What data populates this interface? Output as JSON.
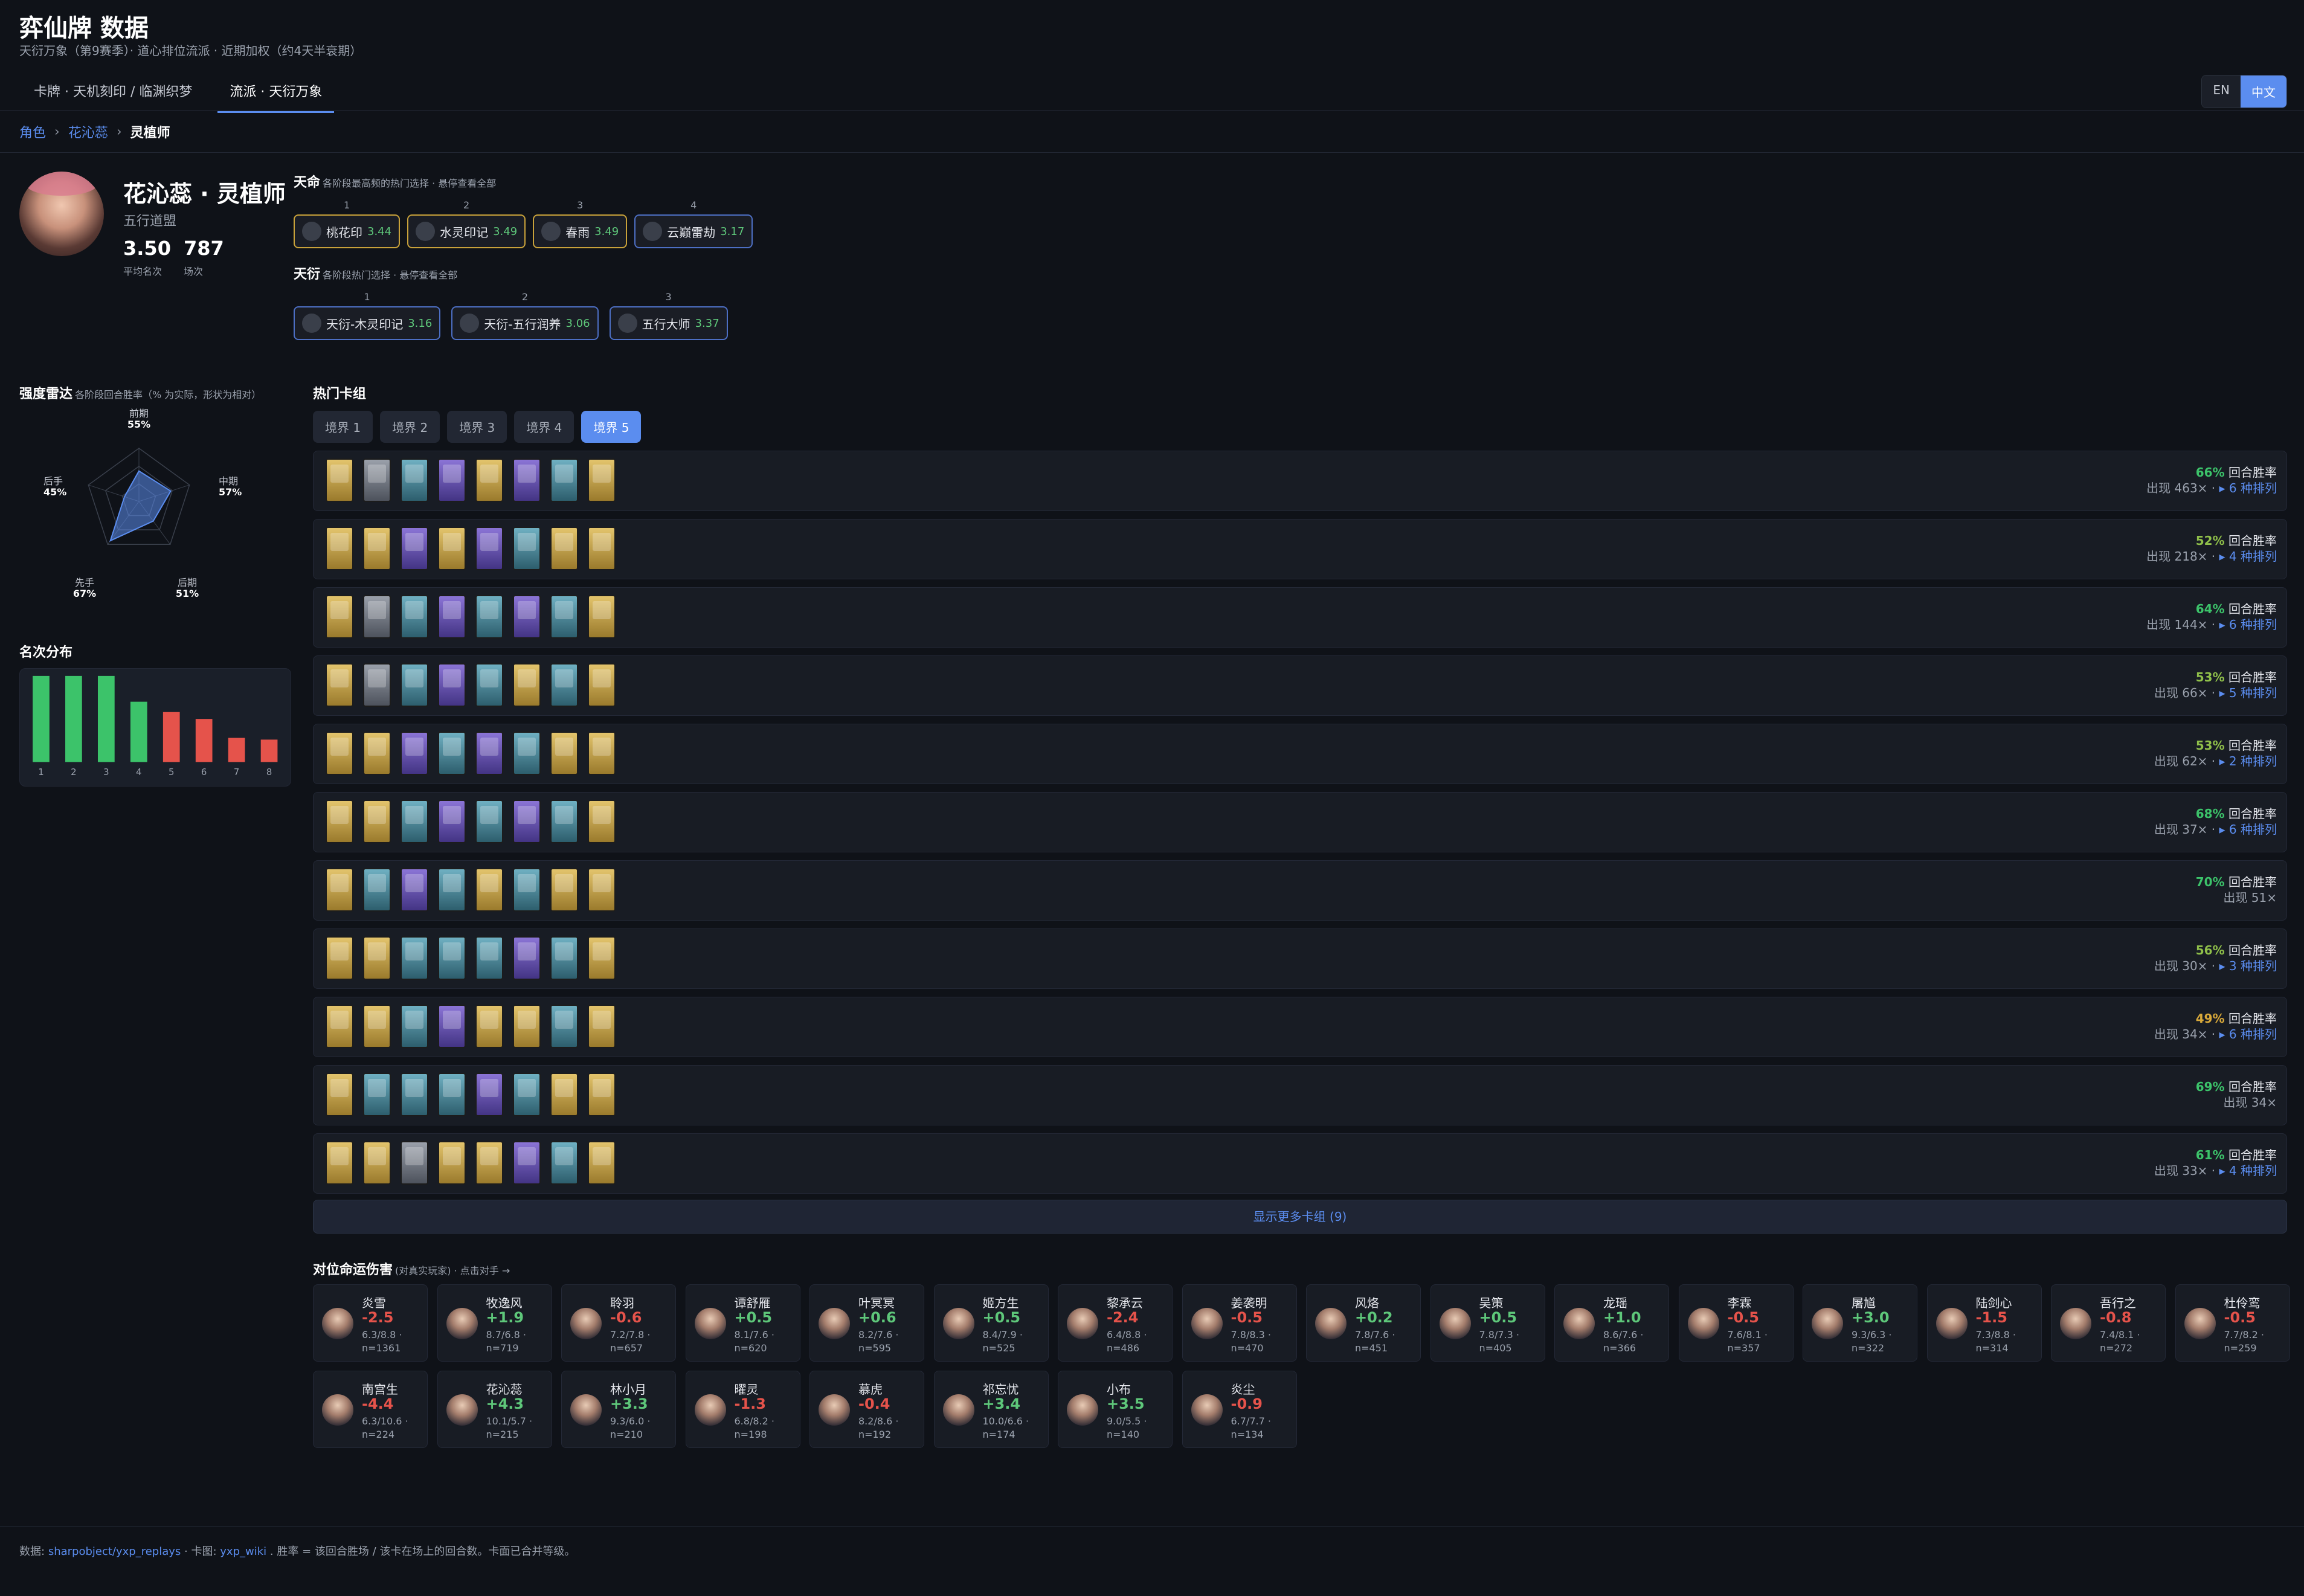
{
  "app": {
    "title": "弈仙牌 数据",
    "subtitle": "天衍万象（第9赛季）· 道心排位流派 · 近期加权（约4天半衰期）"
  },
  "nav": {
    "tabs": [
      {
        "label": "卡牌 · 天机刻印 / 临渊织梦"
      },
      {
        "label": "流派 · 天衍万象"
      }
    ]
  },
  "lang": {
    "en": "EN",
    "zh": "中文"
  },
  "breadcrumb": {
    "a": "角色",
    "b": "花沁蕊",
    "c": "灵植师",
    "sep": "›"
  },
  "hero": {
    "name": "花沁蕊 · 灵植师",
    "faction": "五行道盟",
    "avg": "3.50",
    "avg_label": "平均名次",
    "games": "787",
    "games_label": "场次"
  },
  "destiny": {
    "title": "天命",
    "hint": "各阶段最高频的热门选择 · 悬停查看全部",
    "items": [
      {
        "n": "1",
        "label": "桃花印",
        "v": "3.44",
        "border": "gold"
      },
      {
        "n": "2",
        "label": "水灵印记",
        "v": "3.49",
        "border": "gold"
      },
      {
        "n": "3",
        "label": "春雨",
        "v": "3.49",
        "border": "gold"
      },
      {
        "n": "4",
        "label": "云巅雷劫",
        "v": "3.17",
        "border": "blue"
      }
    ]
  },
  "tianyan": {
    "title": "天衍",
    "hint": "各阶段热门选择 · 悬停查看全部",
    "items": [
      {
        "n": "1",
        "label": "天衍-木灵印记",
        "v": "3.16"
      },
      {
        "n": "2",
        "label": "天衍-五行润养",
        "v": "3.06"
      },
      {
        "n": "3",
        "label": "五行大师",
        "v": "3.37"
      }
    ]
  },
  "radar": {
    "title": "强度雷达",
    "hint": "各阶段回合胜率（% 为实际，形状为相对）",
    "labels": [
      {
        "name": "前期",
        "val": "55%"
      },
      {
        "name": "中期",
        "val": "57%"
      },
      {
        "name": "后期",
        "val": "51%"
      },
      {
        "name": "先手",
        "val": "67%"
      },
      {
        "name": "后手",
        "val": "45%"
      }
    ],
    "values": [
      55,
      57,
      51,
      67,
      45
    ]
  },
  "rankdist": {
    "title": "名次分布",
    "bins": [
      "1",
      "2",
      "3",
      "4",
      "5",
      "6",
      "7",
      "8"
    ],
    "values": [
      100,
      100,
      100,
      70,
      58,
      50,
      28,
      26
    ],
    "colors": [
      "#3cc36a",
      "#3cc36a",
      "#3cc36a",
      "#3cc36a",
      "#e5534b",
      "#e5534b",
      "#e5534b",
      "#e5534b"
    ]
  },
  "decks_section": {
    "title": "热门卡组",
    "tiers": [
      "境界 1",
      "境界 2",
      "境界 3",
      "境界 4",
      "境界 5"
    ],
    "active_tier": 4,
    "wr_suffix": "回合胜率",
    "appear_prefix": "出现 ",
    "variants_suffix": "种排列",
    "more": "显示更多卡组 (9)"
  },
  "decks": [
    {
      "wr": "66%",
      "wrc": "#3cc36a",
      "count": "463×",
      "var": "6",
      "cards": [
        "gold",
        "gray",
        "teal",
        "purple",
        "gold",
        "purple",
        "teal",
        "gold"
      ]
    },
    {
      "wr": "52%",
      "wrc": "#8fbf4a",
      "count": "218×",
      "var": "4",
      "cards": [
        "gold",
        "gold",
        "purple",
        "gold",
        "purple",
        "teal",
        "gold",
        "gold"
      ]
    },
    {
      "wr": "64%",
      "wrc": "#3cc36a",
      "count": "144×",
      "var": "6",
      "cards": [
        "gold",
        "gray",
        "teal",
        "purple",
        "teal",
        "purple",
        "teal",
        "gold"
      ]
    },
    {
      "wr": "53%",
      "wrc": "#8fbf4a",
      "count": "66×",
      "var": "5",
      "cards": [
        "gold",
        "gray",
        "teal",
        "purple",
        "teal",
        "gold",
        "teal",
        "gold"
      ]
    },
    {
      "wr": "53%",
      "wrc": "#8fbf4a",
      "count": "62×",
      "var": "2",
      "cards": [
        "gold",
        "gold",
        "purple",
        "teal",
        "purple",
        "teal",
        "gold",
        "gold"
      ]
    },
    {
      "wr": "68%",
      "wrc": "#3cc36a",
      "count": "37×",
      "var": "6",
      "cards": [
        "gold",
        "gold",
        "teal",
        "purple",
        "teal",
        "purple",
        "teal",
        "gold"
      ]
    },
    {
      "wr": "70%",
      "wrc": "#3cc36a",
      "count": "51×",
      "var": "",
      "cards": [
        "gold",
        "teal",
        "purple",
        "teal",
        "gold",
        "teal",
        "gold",
        "gold"
      ]
    },
    {
      "wr": "56%",
      "wrc": "#8fbf4a",
      "count": "30×",
      "var": "3",
      "cards": [
        "gold",
        "gold",
        "teal",
        "teal",
        "teal",
        "purple",
        "teal",
        "gold"
      ]
    },
    {
      "wr": "49%",
      "wrc": "#d9a93a",
      "count": "34×",
      "var": "6",
      "cards": [
        "gold",
        "gold",
        "teal",
        "purple",
        "gold",
        "gold",
        "teal",
        "gold"
      ]
    },
    {
      "wr": "69%",
      "wrc": "#3cc36a",
      "count": "34×",
      "var": "",
      "cards": [
        "gold",
        "teal",
        "teal",
        "teal",
        "purple",
        "teal",
        "gold",
        "gold"
      ]
    },
    {
      "wr": "61%",
      "wrc": "#3cc36a",
      "count": "33×",
      "var": "4",
      "cards": [
        "gold",
        "gold",
        "gray",
        "gold",
        "gold",
        "purple",
        "teal",
        "gold"
      ]
    }
  ],
  "opponents": {
    "title": "对位命运伤害",
    "hint": "(对真实玩家) · 点击对手 →",
    "items": [
      {
        "name": "炎雪",
        "delta": "-2.5",
        "s1": "6.3/8.8 ·",
        "s2": "n=1361"
      },
      {
        "name": "牧逸风",
        "delta": "+1.9",
        "s1": "8.7/6.8 ·",
        "s2": "n=719"
      },
      {
        "name": "聆羽",
        "delta": "-0.6",
        "s1": "7.2/7.8 ·",
        "s2": "n=657"
      },
      {
        "name": "谭舒雁",
        "delta": "+0.5",
        "s1": "8.1/7.6 ·",
        "s2": "n=620"
      },
      {
        "name": "叶冥冥",
        "delta": "+0.6",
        "s1": "8.2/7.6 ·",
        "s2": "n=595"
      },
      {
        "name": "姬方生",
        "delta": "+0.5",
        "s1": "8.4/7.9 ·",
        "s2": "n=525"
      },
      {
        "name": "黎承云",
        "delta": "-2.4",
        "s1": "6.4/8.8 ·",
        "s2": "n=486"
      },
      {
        "name": "姜袭明",
        "delta": "-0.5",
        "s1": "7.8/8.3 ·",
        "s2": "n=470"
      },
      {
        "name": "风烙",
        "delta": "+0.2",
        "s1": "7.8/7.6 ·",
        "s2": "n=451"
      },
      {
        "name": "吴策",
        "delta": "+0.5",
        "s1": "7.8/7.3 ·",
        "s2": "n=405"
      },
      {
        "name": "龙瑶",
        "delta": "+1.0",
        "s1": "8.6/7.6 ·",
        "s2": "n=366"
      },
      {
        "name": "李霖",
        "delta": "-0.5",
        "s1": "7.6/8.1 ·",
        "s2": "n=357"
      },
      {
        "name": "屠馗",
        "delta": "+3.0",
        "s1": "9.3/6.3 ·",
        "s2": "n=322"
      },
      {
        "name": "陆剑心",
        "delta": "-1.5",
        "s1": "7.3/8.8 ·",
        "s2": "n=314"
      },
      {
        "name": "吾行之",
        "delta": "-0.8",
        "s1": "7.4/8.1 ·",
        "s2": "n=272"
      },
      {
        "name": "杜伶鸾",
        "delta": "-0.5",
        "s1": "7.7/8.2 ·",
        "s2": "n=259"
      },
      {
        "name": "南宫生",
        "delta": "-4.4",
        "s1": "6.3/10.6 ·",
        "s2": "n=224"
      },
      {
        "name": "花沁蕊",
        "delta": "+4.3",
        "s1": "10.1/5.7 ·",
        "s2": "n=215"
      },
      {
        "name": "林小月",
        "delta": "+3.3",
        "s1": "9.3/6.0 ·",
        "s2": "n=210"
      },
      {
        "name": "曜灵",
        "delta": "-1.3",
        "s1": "6.8/8.2 ·",
        "s2": "n=198"
      },
      {
        "name": "慕虎",
        "delta": "-0.4",
        "s1": "8.2/8.6 ·",
        "s2": "n=192"
      },
      {
        "name": "祁忘忧",
        "delta": "+3.4",
        "s1": "10.0/6.6 ·",
        "s2": "n=174"
      },
      {
        "name": "小布",
        "delta": "+3.5",
        "s1": "9.0/5.5 ·",
        "s2": "n=140"
      },
      {
        "name": "炎尘",
        "delta": "-0.9",
        "s1": "6.7/7.7 ·",
        "s2": "n=134"
      }
    ]
  },
  "footer": {
    "p1": "数据:",
    "link1": "sharpobject/yxp_replays",
    "p2": "· 卡图:",
    "link2": "yxp_wiki",
    "p3": ". 胜率 = 该回合胜场 / 该卡在场上的回合数。卡面已合并等级。"
  }
}
